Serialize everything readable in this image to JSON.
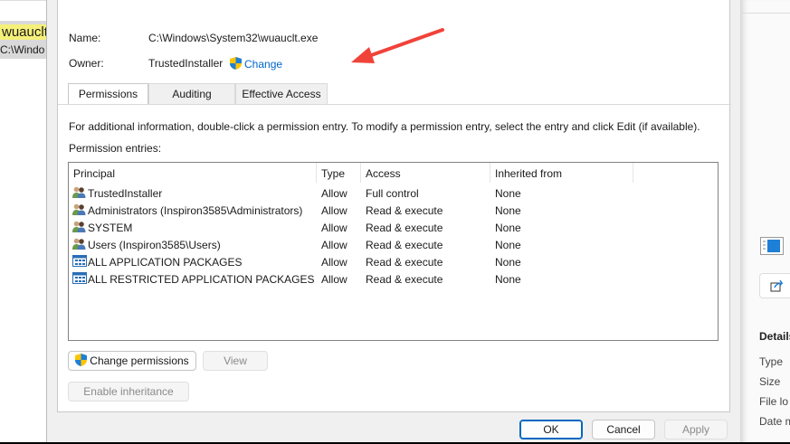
{
  "background_window": {
    "file_name": "wuauclt",
    "path": "C:\\Windo"
  },
  "right_pane": {
    "section_title": "Details",
    "fields": [
      "Type",
      "Size",
      "File lo",
      "Date m"
    ]
  },
  "dialog": {
    "name_label": "Name:",
    "name_value": "C:\\Windows\\System32\\wuauclt.exe",
    "owner_label": "Owner:",
    "owner_value": "TrustedInstaller",
    "change_link": "Change",
    "tabs": [
      {
        "label": "Permissions"
      },
      {
        "label": "Auditing"
      },
      {
        "label": "Effective Access"
      }
    ],
    "info_text": "For additional information, double-click a permission entry. To modify a permission entry, select the entry and click Edit (if available).",
    "entries_label": "Permission entries:",
    "columns": [
      "Principal",
      "Type",
      "Access",
      "Inherited from"
    ],
    "rows": [
      {
        "principal": "TrustedInstaller",
        "type": "Allow",
        "access": "Full control",
        "inherited": "None",
        "icon": "users-icon"
      },
      {
        "principal": "Administrators (Inspiron3585\\Administrators)",
        "type": "Allow",
        "access": "Read & execute",
        "inherited": "None",
        "icon": "users-icon"
      },
      {
        "principal": "SYSTEM",
        "type": "Allow",
        "access": "Read & execute",
        "inherited": "None",
        "icon": "users-icon"
      },
      {
        "principal": "Users (Inspiron3585\\Users)",
        "type": "Allow",
        "access": "Read & execute",
        "inherited": "None",
        "icon": "users-icon"
      },
      {
        "principal": "ALL APPLICATION PACKAGES",
        "type": "Allow",
        "access": "Read & execute",
        "inherited": "None",
        "icon": "package-icon"
      },
      {
        "principal": "ALL RESTRICTED APPLICATION PACKAGES",
        "type": "Allow",
        "access": "Read & execute",
        "inherited": "None",
        "icon": "package-icon"
      }
    ],
    "buttons": {
      "change_permissions": "Change permissions",
      "view": "View",
      "enable_inheritance": "Enable inheritance",
      "ok": "OK",
      "cancel": "Cancel",
      "apply": "Apply"
    }
  },
  "colors": {
    "link": "#0066cc",
    "arrow": "#f0433a",
    "accent": "#0067c0"
  }
}
